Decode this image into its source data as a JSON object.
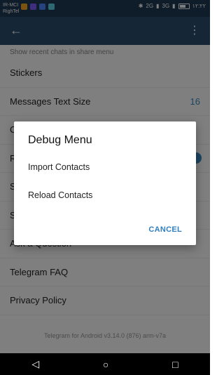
{
  "status_bar": {
    "carrier1": "IR-MCI",
    "carrier2": "RighTel",
    "network": "2G",
    "net2": "3G",
    "time": "۱۲:۲۲",
    "battery": ""
  },
  "settings": {
    "rows": [
      {
        "label": "Show recent chats in share menu"
      },
      {
        "label": "Stickers"
      },
      {
        "label": "Messages Text Size",
        "value": "16"
      },
      {
        "label": "C"
      },
      {
        "label": "R"
      },
      {
        "label": "S"
      },
      {
        "label": "S"
      },
      {
        "label": "Ask a Question"
      },
      {
        "label": "Telegram FAQ"
      },
      {
        "label": "Privacy Policy"
      }
    ],
    "version": "Telegram for Android v3.14.0 (876) arm-v7a"
  },
  "dialog": {
    "title": "Debug Menu",
    "items": [
      "Import Contacts",
      "Reload Contacts"
    ],
    "cancel": "CANCEL"
  },
  "colors": {
    "app_bar": "#2b4d6c",
    "accent": "#3a8bc4"
  }
}
